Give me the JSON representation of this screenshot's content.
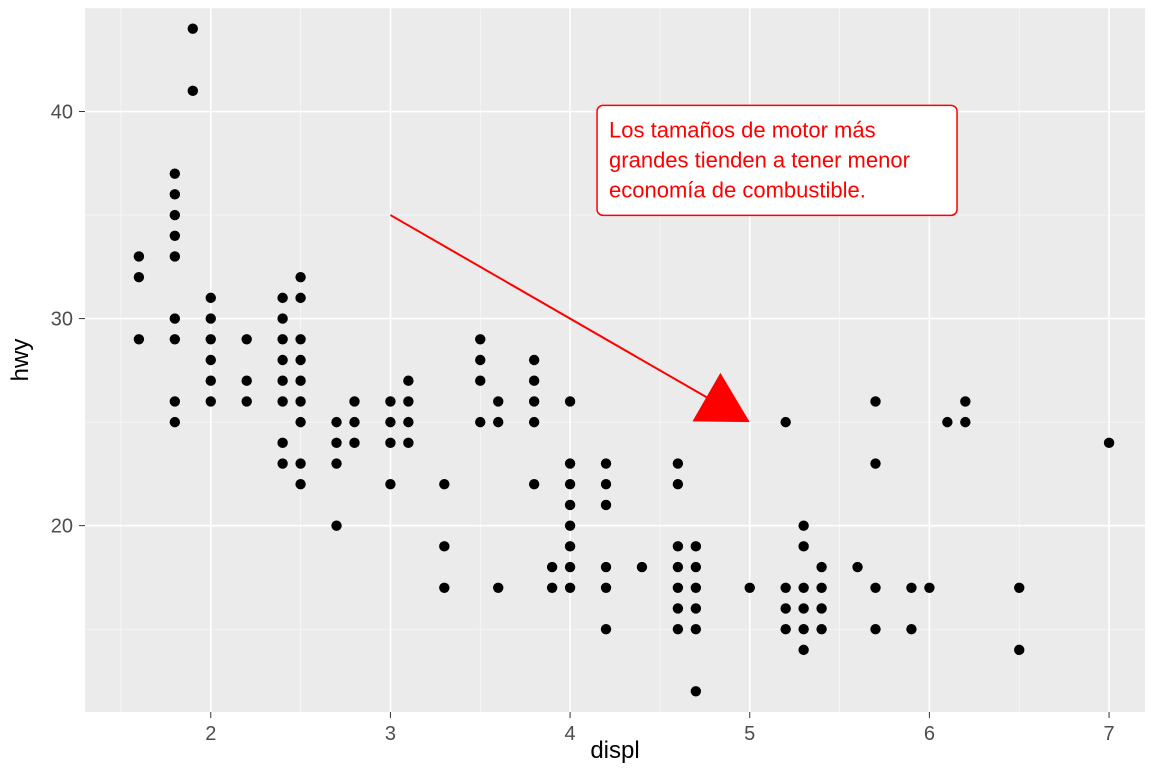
{
  "chart_data": {
    "type": "scatter",
    "xlabel": "displ",
    "ylabel": "hwy",
    "xlim": [
      1.3,
      7.2
    ],
    "ylim": [
      11,
      45
    ],
    "x_ticks": [
      2,
      3,
      4,
      5,
      6,
      7
    ],
    "y_ticks": [
      20,
      30,
      40
    ],
    "x_minor": [
      1.5,
      2.5,
      3.5,
      4.5,
      5.5,
      6.5
    ],
    "y_minor": [
      15,
      25,
      35,
      45
    ],
    "points": [
      {
        "x": 1.6,
        "y": 29
      },
      {
        "x": 1.6,
        "y": 32
      },
      {
        "x": 1.6,
        "y": 33
      },
      {
        "x": 1.8,
        "y": 25
      },
      {
        "x": 1.8,
        "y": 26
      },
      {
        "x": 1.8,
        "y": 29
      },
      {
        "x": 1.8,
        "y": 30
      },
      {
        "x": 1.8,
        "y": 33
      },
      {
        "x": 1.8,
        "y": 34
      },
      {
        "x": 1.8,
        "y": 35
      },
      {
        "x": 1.8,
        "y": 36
      },
      {
        "x": 1.8,
        "y": 37
      },
      {
        "x": 1.9,
        "y": 41
      },
      {
        "x": 1.9,
        "y": 44
      },
      {
        "x": 2.0,
        "y": 26
      },
      {
        "x": 2.0,
        "y": 27
      },
      {
        "x": 2.0,
        "y": 28
      },
      {
        "x": 2.0,
        "y": 29
      },
      {
        "x": 2.0,
        "y": 30
      },
      {
        "x": 2.0,
        "y": 31
      },
      {
        "x": 2.2,
        "y": 26
      },
      {
        "x": 2.2,
        "y": 27
      },
      {
        "x": 2.2,
        "y": 29
      },
      {
        "x": 2.4,
        "y": 23
      },
      {
        "x": 2.4,
        "y": 24
      },
      {
        "x": 2.4,
        "y": 26
      },
      {
        "x": 2.4,
        "y": 27
      },
      {
        "x": 2.4,
        "y": 28
      },
      {
        "x": 2.4,
        "y": 29
      },
      {
        "x": 2.4,
        "y": 30
      },
      {
        "x": 2.4,
        "y": 31
      },
      {
        "x": 2.5,
        "y": 22
      },
      {
        "x": 2.5,
        "y": 23
      },
      {
        "x": 2.5,
        "y": 25
      },
      {
        "x": 2.5,
        "y": 26
      },
      {
        "x": 2.5,
        "y": 27
      },
      {
        "x": 2.5,
        "y": 28
      },
      {
        "x": 2.5,
        "y": 29
      },
      {
        "x": 2.5,
        "y": 31
      },
      {
        "x": 2.5,
        "y": 32
      },
      {
        "x": 2.7,
        "y": 20
      },
      {
        "x": 2.7,
        "y": 23
      },
      {
        "x": 2.7,
        "y": 24
      },
      {
        "x": 2.7,
        "y": 25
      },
      {
        "x": 2.8,
        "y": 24
      },
      {
        "x": 2.8,
        "y": 25
      },
      {
        "x": 2.8,
        "y": 26
      },
      {
        "x": 3.0,
        "y": 22
      },
      {
        "x": 3.0,
        "y": 24
      },
      {
        "x": 3.0,
        "y": 25
      },
      {
        "x": 3.0,
        "y": 26
      },
      {
        "x": 3.1,
        "y": 24
      },
      {
        "x": 3.1,
        "y": 25
      },
      {
        "x": 3.1,
        "y": 26
      },
      {
        "x": 3.1,
        "y": 27
      },
      {
        "x": 3.3,
        "y": 17
      },
      {
        "x": 3.3,
        "y": 19
      },
      {
        "x": 3.3,
        "y": 22
      },
      {
        "x": 3.5,
        "y": 25
      },
      {
        "x": 3.5,
        "y": 27
      },
      {
        "x": 3.5,
        "y": 28
      },
      {
        "x": 3.5,
        "y": 29
      },
      {
        "x": 3.6,
        "y": 25
      },
      {
        "x": 3.6,
        "y": 26
      },
      {
        "x": 3.6,
        "y": 17
      },
      {
        "x": 3.8,
        "y": 22
      },
      {
        "x": 3.8,
        "y": 25
      },
      {
        "x": 3.8,
        "y": 26
      },
      {
        "x": 3.8,
        "y": 27
      },
      {
        "x": 3.8,
        "y": 28
      },
      {
        "x": 3.9,
        "y": 17
      },
      {
        "x": 3.9,
        "y": 18
      },
      {
        "x": 4.0,
        "y": 17
      },
      {
        "x": 4.0,
        "y": 18
      },
      {
        "x": 4.0,
        "y": 19
      },
      {
        "x": 4.0,
        "y": 20
      },
      {
        "x": 4.0,
        "y": 21
      },
      {
        "x": 4.0,
        "y": 22
      },
      {
        "x": 4.0,
        "y": 23
      },
      {
        "x": 4.0,
        "y": 26
      },
      {
        "x": 4.2,
        "y": 15
      },
      {
        "x": 4.2,
        "y": 17
      },
      {
        "x": 4.2,
        "y": 18
      },
      {
        "x": 4.2,
        "y": 21
      },
      {
        "x": 4.2,
        "y": 22
      },
      {
        "x": 4.2,
        "y": 23
      },
      {
        "x": 4.4,
        "y": 18
      },
      {
        "x": 4.6,
        "y": 15
      },
      {
        "x": 4.6,
        "y": 16
      },
      {
        "x": 4.6,
        "y": 17
      },
      {
        "x": 4.6,
        "y": 18
      },
      {
        "x": 4.6,
        "y": 19
      },
      {
        "x": 4.6,
        "y": 22
      },
      {
        "x": 4.6,
        "y": 23
      },
      {
        "x": 4.7,
        "y": 12
      },
      {
        "x": 4.7,
        "y": 15
      },
      {
        "x": 4.7,
        "y": 16
      },
      {
        "x": 4.7,
        "y": 17
      },
      {
        "x": 4.7,
        "y": 18
      },
      {
        "x": 4.7,
        "y": 19
      },
      {
        "x": 5.0,
        "y": 17
      },
      {
        "x": 5.2,
        "y": 15
      },
      {
        "x": 5.2,
        "y": 16
      },
      {
        "x": 5.2,
        "y": 17
      },
      {
        "x": 5.2,
        "y": 25
      },
      {
        "x": 5.3,
        "y": 14
      },
      {
        "x": 5.3,
        "y": 15
      },
      {
        "x": 5.3,
        "y": 16
      },
      {
        "x": 5.3,
        "y": 17
      },
      {
        "x": 5.3,
        "y": 19
      },
      {
        "x": 5.3,
        "y": 20
      },
      {
        "x": 5.4,
        "y": 15
      },
      {
        "x": 5.4,
        "y": 16
      },
      {
        "x": 5.4,
        "y": 17
      },
      {
        "x": 5.4,
        "y": 18
      },
      {
        "x": 5.6,
        "y": 18
      },
      {
        "x": 5.7,
        "y": 15
      },
      {
        "x": 5.7,
        "y": 17
      },
      {
        "x": 5.7,
        "y": 23
      },
      {
        "x": 5.7,
        "y": 26
      },
      {
        "x": 5.9,
        "y": 15
      },
      {
        "x": 5.9,
        "y": 17
      },
      {
        "x": 6.0,
        "y": 17
      },
      {
        "x": 6.1,
        "y": 25
      },
      {
        "x": 6.2,
        "y": 25
      },
      {
        "x": 6.2,
        "y": 26
      },
      {
        "x": 6.5,
        "y": 14
      },
      {
        "x": 6.5,
        "y": 17
      },
      {
        "x": 7.0,
        "y": 24
      }
    ],
    "annotation": {
      "lines": [
        "Los tamaños de motor más",
        "grandes tienden a tener menor",
        "economía de combustible."
      ],
      "box_x": 4.15,
      "box_y_top": 40.3,
      "arrow_start_x": 3.0,
      "arrow_start_y": 35,
      "arrow_end_x": 5.0,
      "arrow_end_y": 25
    },
    "colors": {
      "panel": "#EBEBEB",
      "grid": "#FFFFFF",
      "point": "#000000",
      "annotation": "#FF0000"
    }
  }
}
